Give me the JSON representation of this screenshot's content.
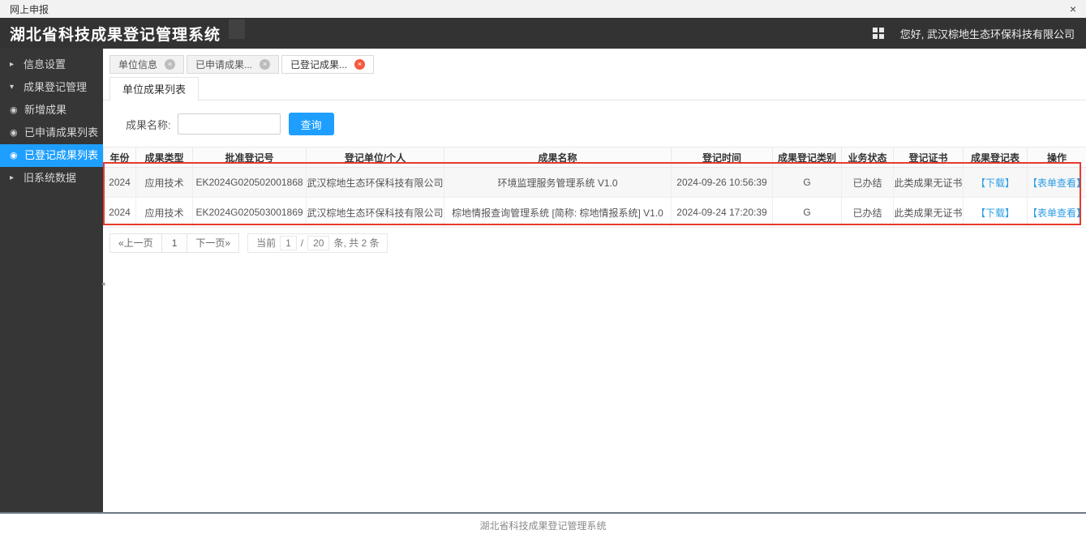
{
  "topbar": {
    "title": "网上申报",
    "close_glyph": "×"
  },
  "header": {
    "title": "湖北省科技成果登记管理系统",
    "greeting": "您好, 武汉棕地生态环保科技有限公司"
  },
  "sidebar": {
    "items": [
      {
        "label": "信息设置",
        "icon": "chevron-right",
        "active": false
      },
      {
        "label": "成果登记管理",
        "icon": "chevron-down",
        "active": false
      },
      {
        "label": "新增成果",
        "icon": "circle-dot",
        "active": false
      },
      {
        "label": "已申请成果列表",
        "icon": "circle-dot",
        "active": false
      },
      {
        "label": "已登记成果列表",
        "icon": "circle-dot",
        "active": true
      },
      {
        "label": "旧系统数据",
        "icon": "chevron-right",
        "active": false
      }
    ]
  },
  "tabs": [
    {
      "label": "单位信息",
      "active": false
    },
    {
      "label": "已申请成果...",
      "active": false
    },
    {
      "label": "已登记成果...",
      "active": true
    }
  ],
  "subtab": {
    "label": "单位成果列表"
  },
  "search": {
    "label": "成果名称:",
    "value": "",
    "button": "查询"
  },
  "table": {
    "columns": [
      "年份",
      "成果类型",
      "批准登记号",
      "登记单位/个人",
      "成果名称",
      "登记时间",
      "成果登记类别",
      "业务状态",
      "登记证书",
      "成果登记表",
      "操作"
    ],
    "rows": [
      [
        "2024",
        "应用技术",
        "EK2024G020502001868",
        "武汉棕地生态环保科技有限公司",
        "环境监理服务管理系统 V1.0",
        "2024-09-26 10:56:39",
        "G",
        "已办结",
        "此类成果无证书",
        "【下载】",
        "【表单查看】"
      ],
      [
        "2024",
        "应用技术",
        "EK2024G020503001869",
        "武汉棕地生态环保科技有限公司",
        "棕地情报查询管理系统 [简称: 棕地情报系统] V1.0",
        "2024-09-24 17:20:39",
        "G",
        "已办结",
        "此类成果无证书",
        "【下载】",
        "【表单查看】"
      ]
    ]
  },
  "pagination": {
    "prev": "«上一页",
    "page": "1",
    "next": "下一页»",
    "current_label": "当前",
    "current_page": "1",
    "separator": "/",
    "page_size": "20",
    "tail": "条, 共 2 条"
  },
  "footer": {
    "text": "湖北省科技成果登记管理系统"
  },
  "colors": {
    "accent_blue": "#1E9FFF",
    "highlight_red": "#e6392e",
    "link_blue": "#2d9de6",
    "dark_chrome": "#333333"
  }
}
